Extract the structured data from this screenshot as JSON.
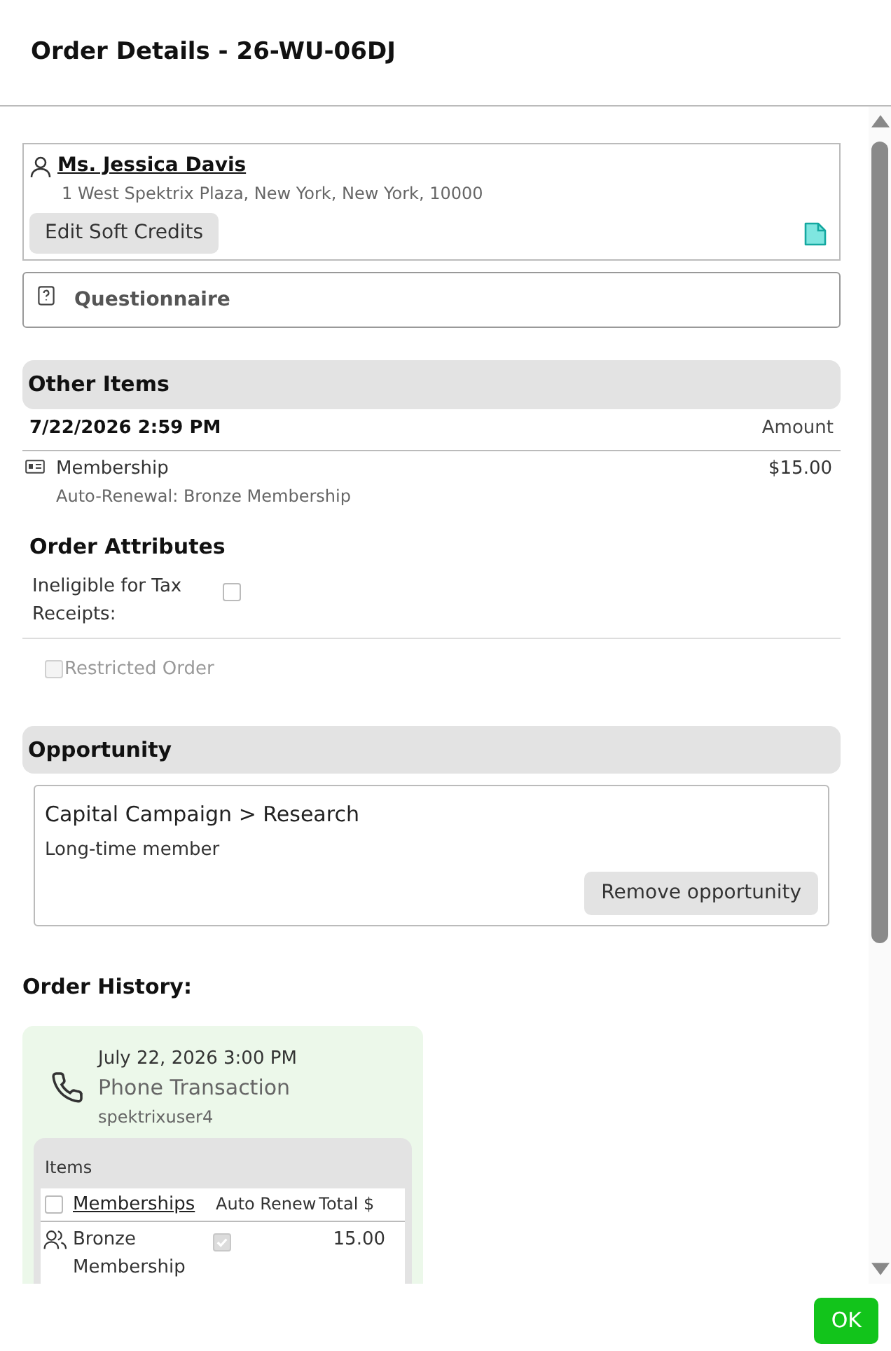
{
  "title": "Order Details - 26-WU-06DJ",
  "customer": {
    "name": "Ms. Jessica Davis",
    "address": "1 West Spektrix Plaza, New York, New York, 10000",
    "button": "Edit Soft Credits"
  },
  "questionnaire": {
    "label": "Questionnaire"
  },
  "other_items": {
    "heading": "Other Items",
    "date": "7/22/2026 2:59 PM",
    "amount_header": "Amount",
    "items": [
      {
        "name": "Membership",
        "detail": "Auto-Renewal: Bronze Membership",
        "amount": "$15.00"
      }
    ]
  },
  "order_attributes": {
    "heading": "Order Attributes",
    "fields": [
      {
        "label": "Ineligible for Tax Receipts:",
        "checked": false
      }
    ],
    "restricted": {
      "label": "Restricted Order",
      "checked": false,
      "disabled": true
    }
  },
  "opportunity": {
    "heading": "Opportunity",
    "name": "Capital Campaign > Research",
    "note": "Long-time member",
    "button": "Remove opportunity"
  },
  "order_history": {
    "heading": "Order History:",
    "entries": [
      {
        "date": "July 22, 2026 3:00 PM",
        "type": "Phone Transaction",
        "user": "spektrixuser4",
        "items_label": "Items",
        "columns": [
          "Memberships",
          "Auto Renew",
          "Total $"
        ],
        "select_all_checked": false,
        "rows": [
          {
            "name": "Bronze Membership",
            "auto_renew": true,
            "total": "15.00"
          }
        ]
      }
    ]
  },
  "footer": {
    "ok": "OK"
  }
}
